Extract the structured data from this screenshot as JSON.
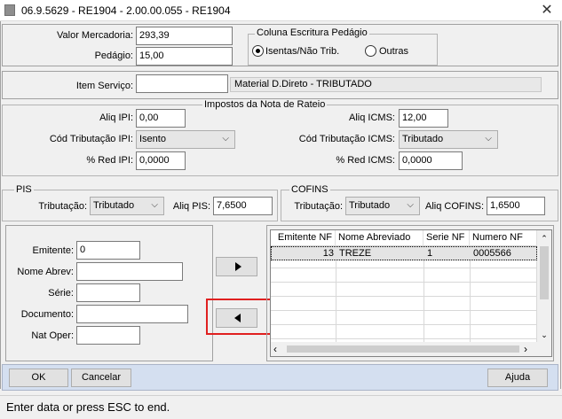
{
  "window": {
    "title": "06.9.5629 - RE1904 - 2.00.00.055 - RE1904"
  },
  "top": {
    "valor_mercadoria_label": "Valor Mercadoria:",
    "valor_mercadoria_value": "293,39",
    "pedagio_label": "Pedágio:",
    "pedagio_value": "15,00",
    "coluna_title": "Coluna Escritura Pedágio",
    "radio_isentas": "Isentas/Não Trib.",
    "radio_outras": "Outras"
  },
  "item": {
    "label": "Item Serviço:",
    "value": "",
    "description": "Material D.Direto - TRIBUTADO"
  },
  "impostos": {
    "title": "Impostos da Nota de Rateio",
    "aliq_ipi_label": "Aliq IPI:",
    "aliq_ipi_value": "0,00",
    "cod_trib_ipi_label": "Cód Tributação IPI:",
    "cod_trib_ipi_value": "Isento",
    "red_ipi_label": "% Red IPI:",
    "red_ipi_value": "0,0000",
    "aliq_icms_label": "Aliq ICMS:",
    "aliq_icms_value": "12,00",
    "cod_trib_icms_label": "Cód Tributação ICMS:",
    "cod_trib_icms_value": "Tributado",
    "red_icms_label": "% Red ICMS:",
    "red_icms_value": "0,0000"
  },
  "pis": {
    "title": "PIS",
    "trib_label": "Tributação:",
    "trib_value": "Tributado",
    "aliq_label": "Aliq PIS:",
    "aliq_value": "7,6500"
  },
  "cofins": {
    "title": "COFINS",
    "trib_label": "Tributação:",
    "trib_value": "Tributado",
    "aliq_label": "Aliq COFINS:",
    "aliq_value": "1,6500"
  },
  "form": {
    "emitente_label": "Emitente:",
    "emitente_value": "0",
    "nome_abrev_label": "Nome Abrev:",
    "nome_abrev_value": "",
    "serie_label": "Série:",
    "serie_value": "",
    "documento_label": "Documento:",
    "documento_value": "",
    "nat_oper_label": "Nat Oper:",
    "nat_oper_value": ""
  },
  "grid": {
    "columns": [
      "Emitente NF",
      "Nome Abreviado",
      "Serie NF",
      "Numero NF"
    ],
    "rows": [
      [
        "13",
        "TREZE",
        "1",
        "0005566"
      ]
    ]
  },
  "buttons": {
    "ok": "OK",
    "cancelar": "Cancelar",
    "ajuda": "Ajuda"
  },
  "status": {
    "text": "Enter data or press ESC to end."
  },
  "colors": {
    "highlight_border": "#e02020",
    "selected_row": "#e4e4e4"
  }
}
